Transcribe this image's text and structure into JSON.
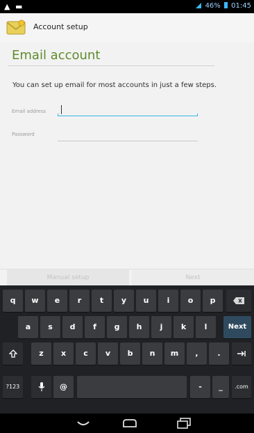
{
  "status_bar": {
    "left_icons": "▲ ▬",
    "battery": "46%",
    "time": "01:45"
  },
  "action_bar": {
    "title": "Account setup",
    "icon": "email-envelope-icon"
  },
  "form": {
    "heading": "Email account",
    "intro": "You can set up email for most accounts in just a few steps.",
    "email_label": "Email address",
    "email_value": "",
    "password_label": "Password",
    "password_value": ""
  },
  "buttons": {
    "manual_setup": "Manual setup",
    "next": "Next"
  },
  "keyboard": {
    "row1": [
      "q",
      "w",
      "e",
      "r",
      "t",
      "y",
      "u",
      "i",
      "o",
      "p"
    ],
    "row2": [
      "a",
      "s",
      "d",
      "f",
      "g",
      "h",
      "j",
      "k",
      "l"
    ],
    "row3": [
      "z",
      "x",
      "c",
      "v",
      "b",
      "n",
      "m",
      ",",
      "."
    ],
    "next_key": "Next",
    "symbols_key": "?123",
    "at_key": "@",
    "dash_key": "-",
    "underscore_key": "_",
    "com_key": ".com"
  },
  "colors": {
    "accent": "#32b5e5",
    "heading": "#5f8b2b",
    "keyboard_bg": "#202124",
    "key_bg": "#3b3c3f"
  }
}
